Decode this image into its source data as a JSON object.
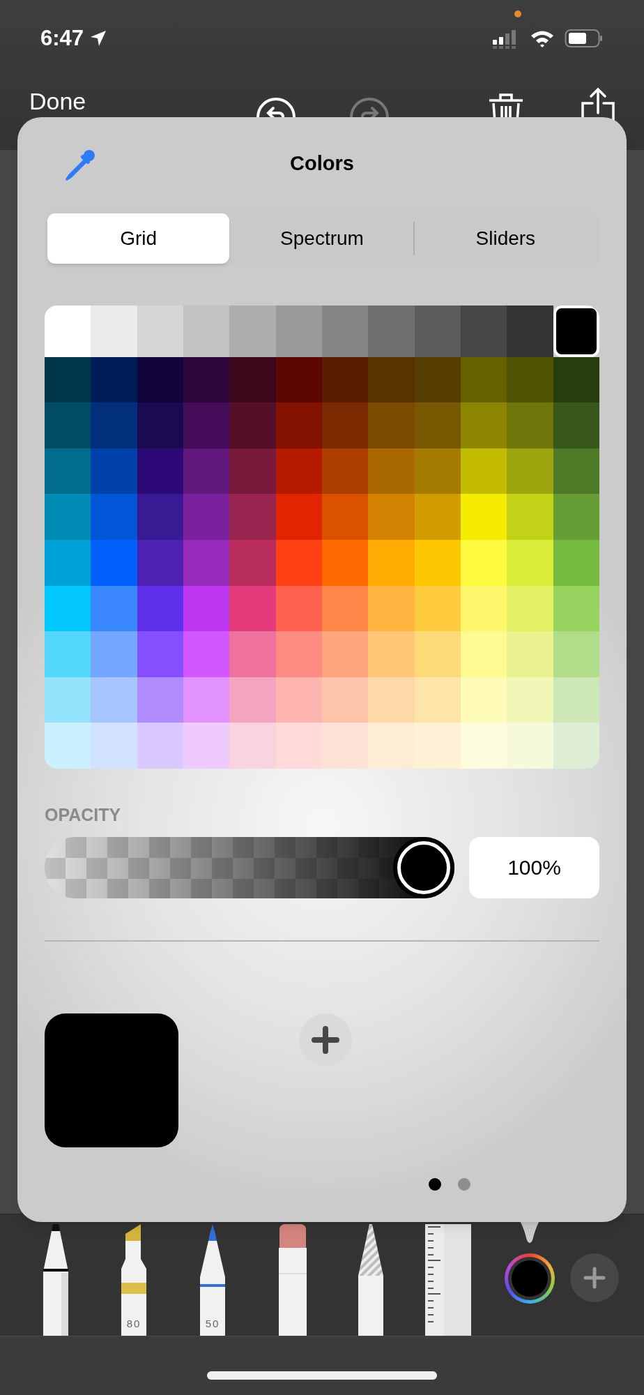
{
  "status_bar": {
    "time": "6:47"
  },
  "toolbar": {
    "done": "Done",
    "buttons": [
      {
        "kind": "undo",
        "disabled": false
      },
      {
        "kind": "redo",
        "disabled": true
      },
      {
        "kind": "trash",
        "disabled": false
      },
      {
        "kind": "share",
        "disabled": false
      }
    ]
  },
  "popover": {
    "title": "Colors",
    "tabs": [
      {
        "label": "Grid",
        "selected": true
      },
      {
        "label": "Spectrum",
        "selected": false
      },
      {
        "label": "Sliders",
        "selected": false
      }
    ],
    "grid": {
      "rows": [
        [
          {
            "color": "#ffffff",
            "selected": false
          },
          {
            "color": "#ebebeb",
            "selected": false
          },
          {
            "color": "#d6d6d6",
            "selected": false
          },
          {
            "color": "#c2c2c2",
            "selected": false
          },
          {
            "color": "#adadad",
            "selected": false
          },
          {
            "color": "#999999",
            "selected": false
          },
          {
            "color": "#858585",
            "selected": false
          },
          {
            "color": "#707070",
            "selected": false
          },
          {
            "color": "#5c5c5c",
            "selected": false
          },
          {
            "color": "#474747",
            "selected": false
          },
          {
            "color": "#333333",
            "selected": false
          },
          {
            "color": "#000000",
            "selected": true
          }
        ],
        [
          {
            "color": "#00374a",
            "selected": false
          },
          {
            "color": "#011d57",
            "selected": false
          },
          {
            "color": "#11053b",
            "selected": false
          },
          {
            "color": "#2e063d",
            "selected": false
          },
          {
            "color": "#3c071b",
            "selected": false
          },
          {
            "color": "#5c0701",
            "selected": false
          },
          {
            "color": "#5a1c00",
            "selected": false
          },
          {
            "color": "#583300",
            "selected": false
          },
          {
            "color": "#563d00",
            "selected": false
          },
          {
            "color": "#666100",
            "selected": false
          },
          {
            "color": "#4f5504",
            "selected": false
          },
          {
            "color": "#263e0f",
            "selected": false
          }
        ],
        [
          {
            "color": "#004d65",
            "selected": false
          },
          {
            "color": "#012f7b",
            "selected": false
          },
          {
            "color": "#1a0a52",
            "selected": false
          },
          {
            "color": "#450d59",
            "selected": false
          },
          {
            "color": "#551029",
            "selected": false
          },
          {
            "color": "#831100",
            "selected": false
          },
          {
            "color": "#7b2900",
            "selected": false
          },
          {
            "color": "#7a4a00",
            "selected": false
          },
          {
            "color": "#785800",
            "selected": false
          },
          {
            "color": "#8d8602",
            "selected": false
          },
          {
            "color": "#6f760a",
            "selected": false
          },
          {
            "color": "#38571a",
            "selected": false
          }
        ],
        [
          {
            "color": "#016e8f",
            "selected": false
          },
          {
            "color": "#0042a9",
            "selected": false
          },
          {
            "color": "#2c0977",
            "selected": false
          },
          {
            "color": "#61187c",
            "selected": false
          },
          {
            "color": "#791a3d",
            "selected": false
          },
          {
            "color": "#b51a00",
            "selected": false
          },
          {
            "color": "#ad3e00",
            "selected": false
          },
          {
            "color": "#a96800",
            "selected": false
          },
          {
            "color": "#a67b01",
            "selected": false
          },
          {
            "color": "#c4bc00",
            "selected": false
          },
          {
            "color": "#9ba50e",
            "selected": false
          },
          {
            "color": "#4e7a27",
            "selected": false
          }
        ],
        [
          {
            "color": "#008cb4",
            "selected": false
          },
          {
            "color": "#0056d6",
            "selected": false
          },
          {
            "color": "#371a94",
            "selected": false
          },
          {
            "color": "#7a219e",
            "selected": false
          },
          {
            "color": "#99244f",
            "selected": false
          },
          {
            "color": "#e22400",
            "selected": false
          },
          {
            "color": "#da5100",
            "selected": false
          },
          {
            "color": "#d38301",
            "selected": false
          },
          {
            "color": "#d19d01",
            "selected": false
          },
          {
            "color": "#f5ec00",
            "selected": false
          },
          {
            "color": "#c3d117",
            "selected": false
          },
          {
            "color": "#669d34",
            "selected": false
          }
        ],
        [
          {
            "color": "#00a1d8",
            "selected": false
          },
          {
            "color": "#0061fd",
            "selected": false
          },
          {
            "color": "#4d22b2",
            "selected": false
          },
          {
            "color": "#982abc",
            "selected": false
          },
          {
            "color": "#b92d5d",
            "selected": false
          },
          {
            "color": "#ff4015",
            "selected": false
          },
          {
            "color": "#ff6a00",
            "selected": false
          },
          {
            "color": "#ffab01",
            "selected": false
          },
          {
            "color": "#fcc700",
            "selected": false
          },
          {
            "color": "#fefb41",
            "selected": false
          },
          {
            "color": "#d9ec37",
            "selected": false
          },
          {
            "color": "#76bb40",
            "selected": false
          }
        ],
        [
          {
            "color": "#01c7fc",
            "selected": false
          },
          {
            "color": "#3a87fd",
            "selected": false
          },
          {
            "color": "#5e30eb",
            "selected": false
          },
          {
            "color": "#be38f3",
            "selected": false
          },
          {
            "color": "#e63b7a",
            "selected": false
          },
          {
            "color": "#fe6250",
            "selected": false
          },
          {
            "color": "#fe8648",
            "selected": false
          },
          {
            "color": "#feb43f",
            "selected": false
          },
          {
            "color": "#fecb3e",
            "selected": false
          },
          {
            "color": "#fff76b",
            "selected": false
          },
          {
            "color": "#e4ef65",
            "selected": false
          },
          {
            "color": "#96d35f",
            "selected": false
          }
        ],
        [
          {
            "color": "#52d6fc",
            "selected": false
          },
          {
            "color": "#74a7ff",
            "selected": false
          },
          {
            "color": "#864ffd",
            "selected": false
          },
          {
            "color": "#d357fe",
            "selected": false
          },
          {
            "color": "#ee719e",
            "selected": false
          },
          {
            "color": "#ff8c82",
            "selected": false
          },
          {
            "color": "#fea57d",
            "selected": false
          },
          {
            "color": "#fec777",
            "selected": false
          },
          {
            "color": "#fed977",
            "selected": false
          },
          {
            "color": "#fff994",
            "selected": false
          },
          {
            "color": "#eaf28f",
            "selected": false
          },
          {
            "color": "#b1dd8b",
            "selected": false
          }
        ],
        [
          {
            "color": "#93e3fc",
            "selected": false
          },
          {
            "color": "#a7c6ff",
            "selected": false
          },
          {
            "color": "#b18cfe",
            "selected": false
          },
          {
            "color": "#e292fe",
            "selected": false
          },
          {
            "color": "#f4a4c0",
            "selected": false
          },
          {
            "color": "#ffb5af",
            "selected": false
          },
          {
            "color": "#ffc5ab",
            "selected": false
          },
          {
            "color": "#fed9a8",
            "selected": false
          },
          {
            "color": "#fde4a8",
            "selected": false
          },
          {
            "color": "#fffbb9",
            "selected": false
          },
          {
            "color": "#f1f7b7",
            "selected": false
          },
          {
            "color": "#cde8b5",
            "selected": false
          }
        ],
        [
          {
            "color": "#cbf0ff",
            "selected": false
          },
          {
            "color": "#d3e2ff",
            "selected": false
          },
          {
            "color": "#d9c9fe",
            "selected": false
          },
          {
            "color": "#efcafe",
            "selected": false
          },
          {
            "color": "#f9d3e0",
            "selected": false
          },
          {
            "color": "#ffdad8",
            "selected": false
          },
          {
            "color": "#ffe2d6",
            "selected": false
          },
          {
            "color": "#feecd4",
            "selected": false
          },
          {
            "color": "#fef1d5",
            "selected": false
          },
          {
            "color": "#fdfbdd",
            "selected": false
          },
          {
            "color": "#f6fadb",
            "selected": false
          },
          {
            "color": "#deeed4",
            "selected": false
          }
        ]
      ]
    },
    "opacity": {
      "label": "OPACITY",
      "level": 1.0,
      "value": "100%"
    },
    "current_color": {
      "color": "#000000"
    },
    "page_dots": [
      {
        "selected": true
      },
      {
        "selected": false
      }
    ]
  },
  "tools": [
    {
      "kind": "pen"
    },
    {
      "kind": "marker",
      "label": "80"
    },
    {
      "kind": "pencil",
      "label": "50"
    },
    {
      "kind": "eraser"
    },
    {
      "kind": "lasso"
    },
    {
      "kind": "ruler"
    }
  ],
  "tool_color": {
    "color": "#000000"
  }
}
